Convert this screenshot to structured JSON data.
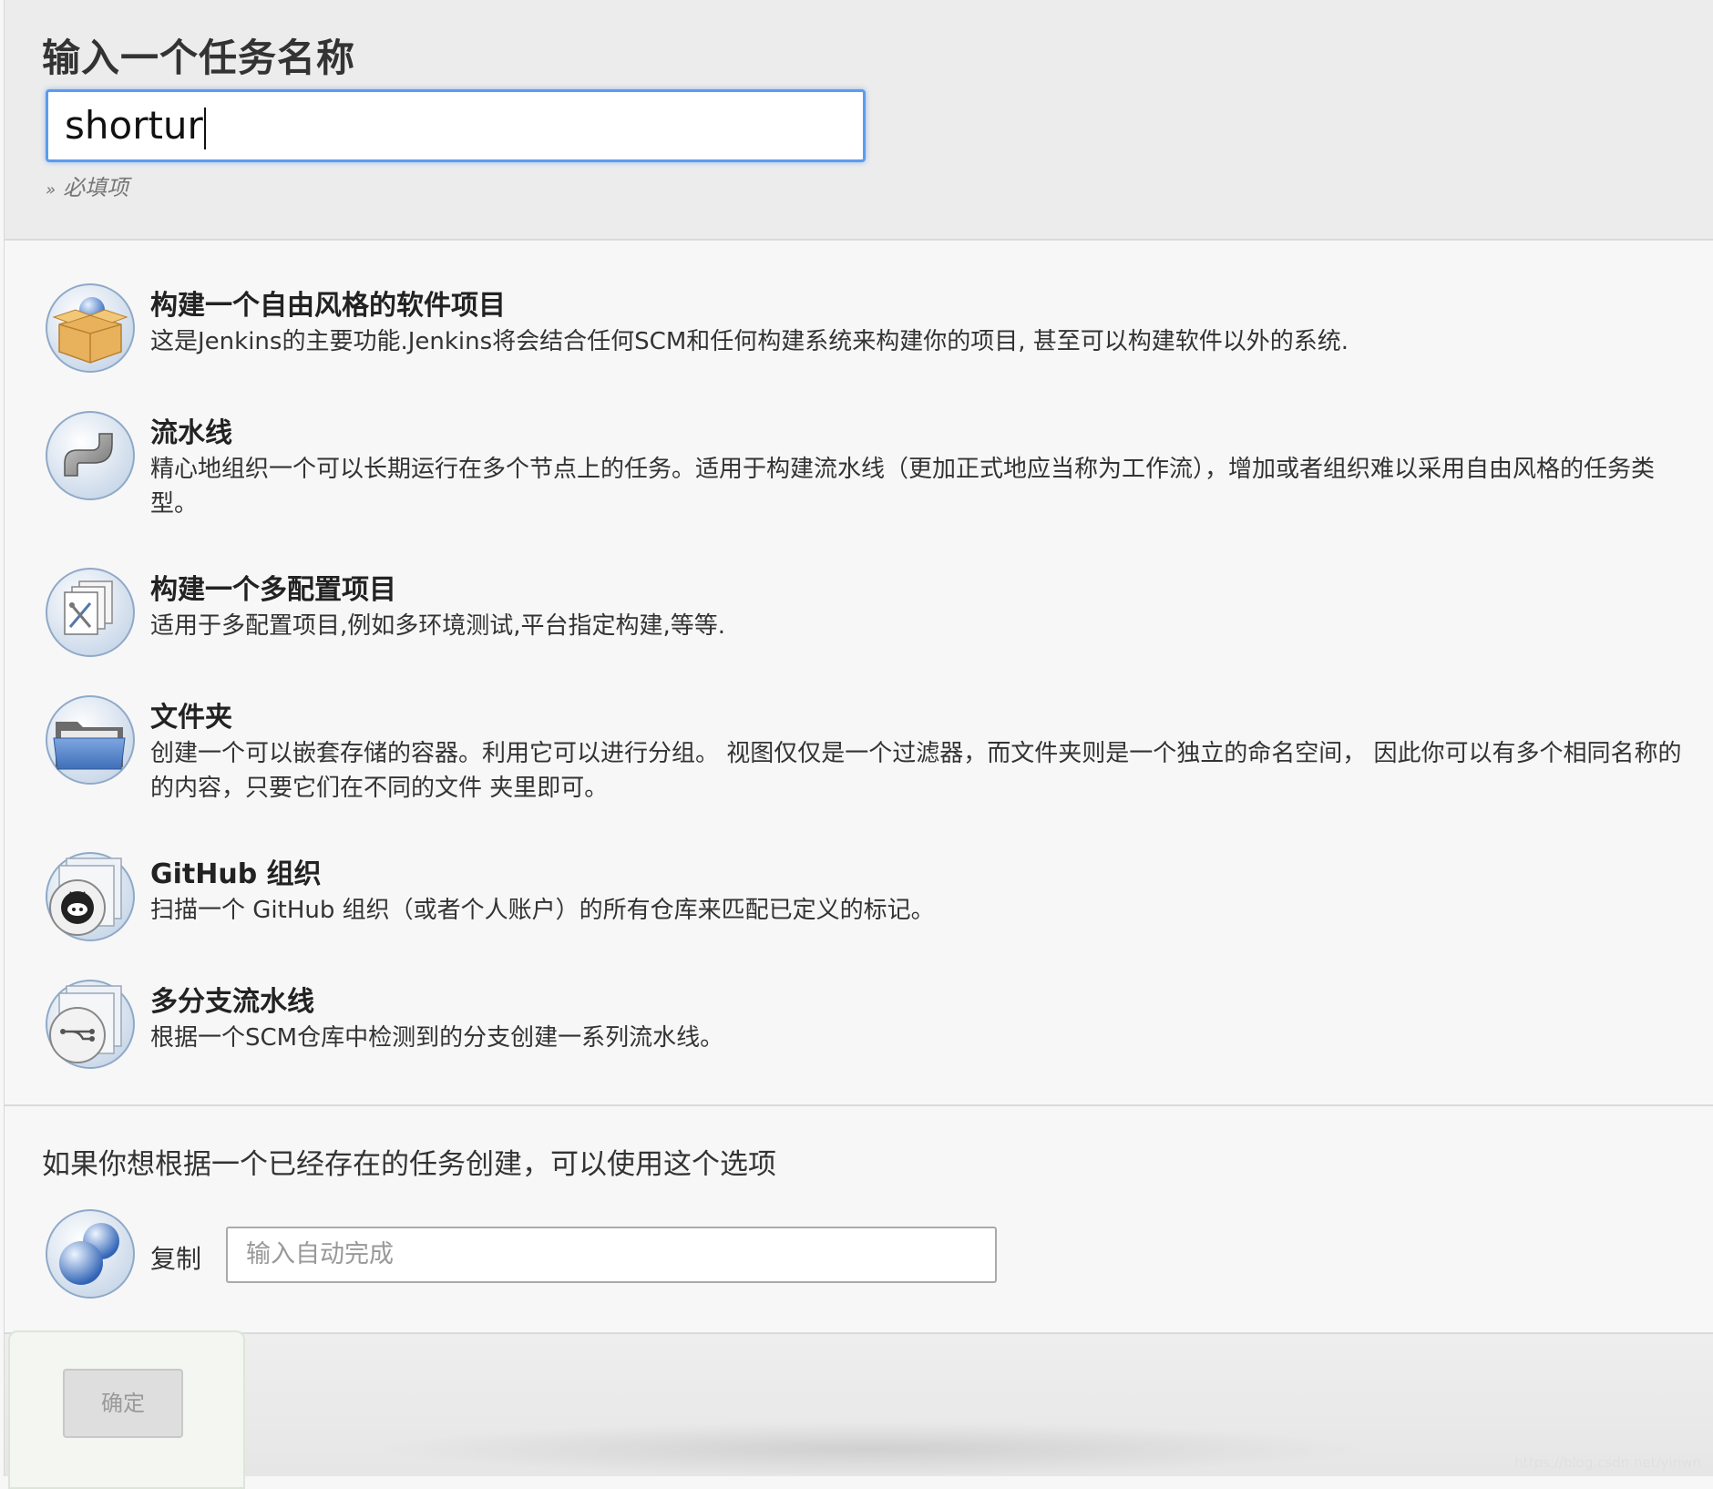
{
  "name_section": {
    "title": "输入一个任务名称",
    "input_value": "shortur",
    "required_note": "必填项",
    "required_prefix": "»"
  },
  "items": [
    {
      "title": "构建一个自由风格的软件项目",
      "description": "这是Jenkins的主要功能.Jenkins将会结合任何SCM和任何构建系统来构建你的项目, 甚至可以构建软件以外的系统.",
      "icon": "freestyle-box-icon"
    },
    {
      "title": "流水线",
      "description": "精心地组织一个可以长期运行在多个节点上的任务。适用于构建流水线（更加正式地应当称为工作流），增加或者组织难以采用自由风格的任务类型。",
      "icon": "pipe-icon"
    },
    {
      "title": "构建一个多配置项目",
      "description": "适用于多配置项目,例如多环境测试,平台指定构建,等等.",
      "icon": "multi-config-icon"
    },
    {
      "title": "文件夹",
      "description": "创建一个可以嵌套存储的容器。利用它可以进行分组。 视图仅仅是一个过滤器，而文件夹则是一个独立的命名空间， 因此你可以有多个相同名称的的内容，只要它们在不同的文件 夹里即可。",
      "icon": "folder-icon"
    },
    {
      "title": "GitHub 组织",
      "description": "扫描一个 GitHub 组织（或者个人账户）的所有仓库来匹配已定义的标记。",
      "icon": "github-org-icon"
    },
    {
      "title": "多分支流水线",
      "description": "根据一个SCM仓库中检测到的分支创建一系列流水线。",
      "icon": "multibranch-icon"
    }
  ],
  "copy_section": {
    "heading": "如果你想根据一个已经存在的任务创建，可以使用这个选项",
    "label": "复制",
    "input_placeholder": "输入自动完成"
  },
  "ok_button": "确定",
  "watermark": "https://blog.csdn.net/yinwn",
  "colors": {
    "focus_border": "#5b9cef",
    "header_bg": "#ececec",
    "body_bg": "#f7f7f7"
  }
}
